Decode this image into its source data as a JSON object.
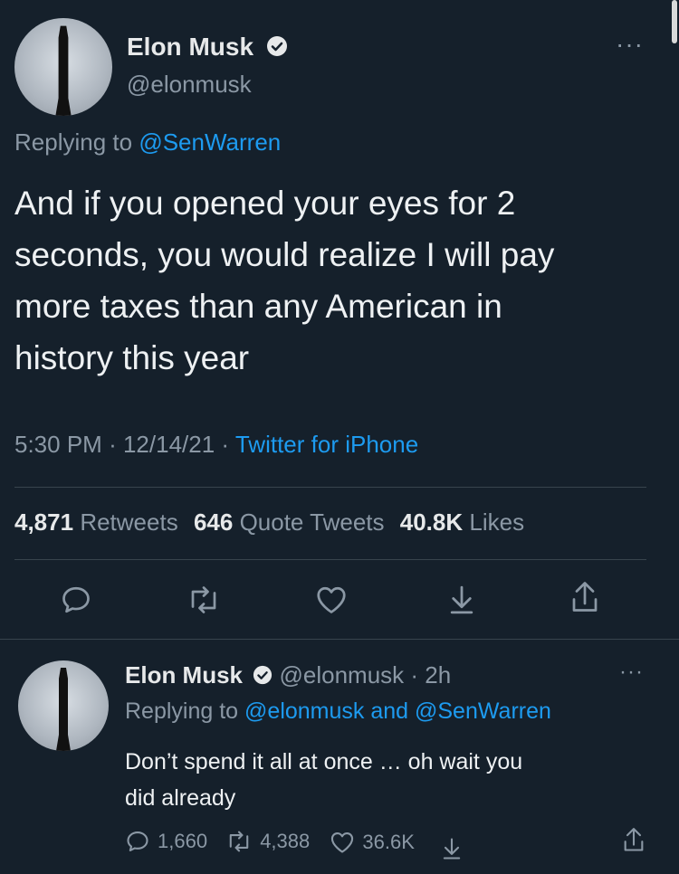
{
  "main_tweet": {
    "author_name": "Elon Musk",
    "author_handle": "@elonmusk",
    "replying_prefix": "Replying to",
    "replying_to": "@SenWarren",
    "text_lines": [
      "And if you opened your eyes for 2",
      "seconds, you would realize I will pay",
      "more taxes than any American in",
      "history this year"
    ],
    "time": "5:30 PM",
    "date": "12/14/21",
    "source": "Twitter for iPhone",
    "separator": "·",
    "retweets_count": "4,871",
    "retweets_label": "Retweets",
    "quotes_count": "646",
    "quotes_label": "Quote Tweets",
    "likes_count": "40.8K",
    "likes_label": "Likes"
  },
  "reply_tweet": {
    "author_name": "Elon Musk",
    "author_handle": "@elonmusk",
    "separator": "·",
    "time_ago": "2h",
    "replying_prefix": "Replying to",
    "replying_to": "@elonmusk and @SenWarren",
    "text_lines": [
      "Don’t spend it all at once … oh wait you",
      "did already"
    ],
    "reply_count": "1,660",
    "retweet_count": "4,388",
    "like_count": "36.6K"
  },
  "colors": {
    "background": "#15202b",
    "text": "#e7e9ea",
    "muted": "#8b98a5",
    "link": "#1d9bf0",
    "divider": "#38444d"
  }
}
